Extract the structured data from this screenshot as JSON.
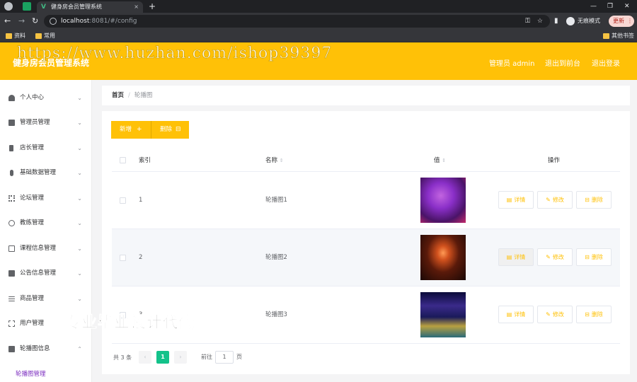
{
  "browser": {
    "tab_title": "健身房会员管理系统",
    "url_host": "localhost",
    "url_path": ":8081/#/config",
    "incognito_label": "无痕模式",
    "update_label": "更新",
    "bookmarks": [
      "资料",
      "常用"
    ],
    "other_bookmarks": "其他书签"
  },
  "header": {
    "title": "健身房会员管理系统",
    "watermark": "https://www.huzhan.com/ishop39397",
    "user_label": "管理员 admin",
    "back_label": "退出到前台",
    "logout_label": "退出登录"
  },
  "sidebar": {
    "items": [
      {
        "label": "个人中心",
        "icon": "user-icon"
      },
      {
        "label": "管理员管理",
        "icon": "briefcase-icon"
      },
      {
        "label": "店长管理",
        "icon": "phone-icon"
      },
      {
        "label": "基础数据管理",
        "icon": "mic-icon"
      },
      {
        "label": "论坛管理",
        "icon": "grid-icon"
      },
      {
        "label": "教练管理",
        "icon": "power-icon"
      },
      {
        "label": "课程信息管理",
        "icon": "copy-icon"
      },
      {
        "label": "公告信息管理",
        "icon": "chart-icon"
      },
      {
        "label": "商品管理",
        "icon": "list-icon"
      },
      {
        "label": "用户管理",
        "icon": "fullscreen-icon"
      },
      {
        "label": "轮播图信息",
        "icon": "notebook-icon"
      }
    ],
    "active_sub": "轮播图管理"
  },
  "breadcrumb": {
    "home": "首页",
    "current": "轮播图"
  },
  "toolbar": {
    "add_label": "新增",
    "delete_label": "删除"
  },
  "table": {
    "headers": {
      "index": "索引",
      "name": "名称",
      "value": "值",
      "ops": "操作"
    },
    "rows": [
      {
        "index": "1",
        "name": "轮播图1"
      },
      {
        "index": "2",
        "name": "轮播图2"
      },
      {
        "index": "3",
        "name": "轮播图3"
      }
    ],
    "op_labels": {
      "detail": "详情",
      "edit": "修改",
      "delete": "删除"
    }
  },
  "pagination": {
    "total": "共 3 条",
    "page": "1",
    "goto": "前往",
    "goto_value": "1",
    "page_suffix": "页"
  },
  "watermark_cn": "专业毕业设计代做",
  "colors": {
    "accent": "#ffc107",
    "pager_active": "#13c28a",
    "submenu": "#7b2cbf"
  }
}
